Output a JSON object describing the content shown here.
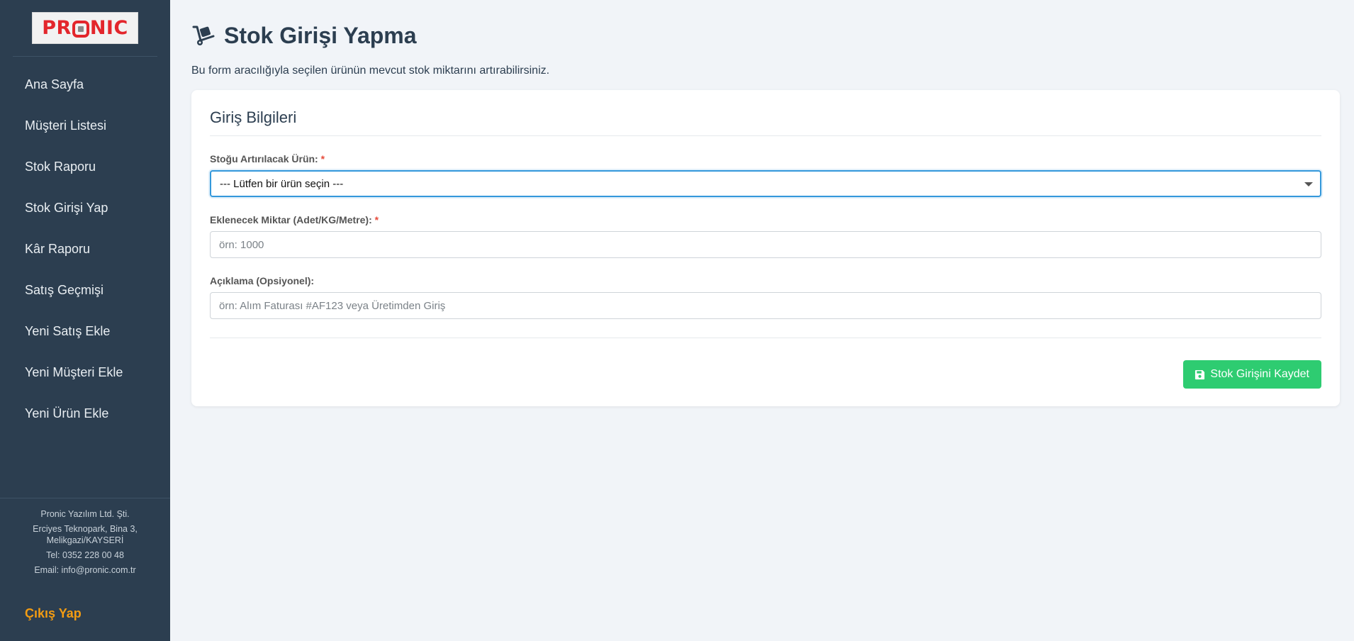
{
  "brand": {
    "logo_text_before": "PR",
    "logo_text_after": "NIC",
    "logo_color": "#e3262c"
  },
  "sidebar": {
    "items": [
      {
        "label": "Ana Sayfa"
      },
      {
        "label": "Müşteri Listesi"
      },
      {
        "label": "Stok Raporu"
      },
      {
        "label": "Stok Girişi Yap"
      },
      {
        "label": "Kâr Raporu"
      },
      {
        "label": "Satış Geçmişi"
      },
      {
        "label": "Yeni Satış Ekle"
      },
      {
        "label": "Yeni Müşteri Ekle"
      },
      {
        "label": "Yeni Ürün Ekle"
      }
    ],
    "footer": {
      "company": "Pronic Yazılım Ltd. Şti.",
      "address": "Erciyes Teknopark, Bina 3, Melikgazi/KAYSERİ",
      "phone": "Tel: 0352 228 00 48",
      "email": "Email: info@pronic.com.tr"
    },
    "logout_label": "Çıkış Yap"
  },
  "page": {
    "title": "Stok Girişi Yapma",
    "title_icon": "dolly-icon",
    "subtitle": "Bu form aracılığıyla seçilen ürünün mevcut stok miktarını artırabilirsiniz."
  },
  "form": {
    "section_title": "Giriş Bilgileri",
    "product": {
      "label": "Stoğu Artırılacak Ürün:",
      "required_mark": "*",
      "selected": "--- Lütfen bir ürün seçin ---"
    },
    "quantity": {
      "label": "Eklenecek Miktar (Adet/KG/Metre):",
      "required_mark": "*",
      "placeholder": "örn: 1000"
    },
    "description": {
      "label": "Açıklama (Opsiyonel):",
      "placeholder": "örn: Alım Faturası #AF123 veya Üretimden Giriş"
    },
    "submit_label": "Stok Girişini Kaydet"
  },
  "colors": {
    "sidebar_bg": "#2c3e50",
    "accent_orange": "#f39c12",
    "save_green": "#2ecc71",
    "focus_blue": "#3498db",
    "required_red": "#e74c3c"
  }
}
